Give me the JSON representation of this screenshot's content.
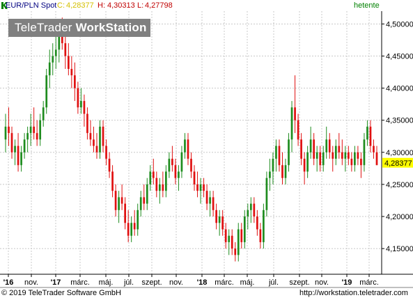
{
  "header": {
    "symbol": "EUR/PLN Spot",
    "close_label": "C:",
    "close_value": "4,28377",
    "high_label": "H:",
    "high_value": "4,30313",
    "low_label": "L:",
    "low_value": "4,27798",
    "period": "hetente"
  },
  "watermark": {
    "part1": "TeleTrader",
    "part2": "WorkStation"
  },
  "footer": {
    "copyright": "© 2019 TeleTrader Software GmbH",
    "url": "http://workstation.teletrader.com"
  },
  "colors": {
    "up": "#1e8c1e",
    "down": "#e01010",
    "grid": "#c8c8c8",
    "price_tag": "#ffff00"
  },
  "chart_data": {
    "type": "candlestick",
    "title": "EUR/PLN Spot",
    "ylim": [
      4.11,
      4.52
    ],
    "y_ticks": [
      "4,50000",
      "4,45000",
      "4,40000",
      "4,35000",
      "4,30000",
      "4,25000",
      "4,20000",
      "4,15000"
    ],
    "y_tick_values": [
      4.5,
      4.45,
      4.4,
      4.35,
      4.3,
      4.25,
      4.2,
      4.15
    ],
    "x_ticks": [
      "'16",
      "nov.",
      "'17",
      "márc.",
      "máj.",
      "júl.",
      "szept.",
      "nov.",
      "'18",
      "márc.",
      "máj.",
      "júl.",
      "szept.",
      "nov.",
      "'19",
      "márc."
    ],
    "last_price_label": "4,28377",
    "last_price": 4.28377,
    "grid": true,
    "series": [
      {
        "values": [
          [
            4.32,
            4.36,
            4.3,
            4.34
          ],
          [
            4.34,
            4.37,
            4.31,
            4.33
          ],
          [
            4.33,
            4.34,
            4.29,
            4.3
          ],
          [
            4.3,
            4.32,
            4.28,
            4.31
          ],
          [
            4.31,
            4.33,
            4.27,
            4.28
          ],
          [
            4.28,
            4.31,
            4.27,
            4.3
          ],
          [
            4.3,
            4.33,
            4.29,
            4.32
          ],
          [
            4.32,
            4.34,
            4.3,
            4.33
          ],
          [
            4.33,
            4.36,
            4.31,
            4.34
          ],
          [
            4.34,
            4.37,
            4.32,
            4.33
          ],
          [
            4.33,
            4.35,
            4.31,
            4.32
          ],
          [
            4.32,
            4.36,
            4.31,
            4.35
          ],
          [
            4.35,
            4.38,
            4.34,
            4.37
          ],
          [
            4.37,
            4.43,
            4.36,
            4.42
          ],
          [
            4.42,
            4.46,
            4.4,
            4.44
          ],
          [
            4.44,
            4.47,
            4.42,
            4.45
          ],
          [
            4.45,
            4.49,
            4.43,
            4.46
          ],
          [
            4.46,
            4.5,
            4.44,
            4.49
          ],
          [
            4.49,
            4.51,
            4.46,
            4.47
          ],
          [
            4.47,
            4.48,
            4.43,
            4.45
          ],
          [
            4.45,
            4.47,
            4.42,
            4.43
          ],
          [
            4.43,
            4.45,
            4.4,
            4.42
          ],
          [
            4.42,
            4.44,
            4.38,
            4.4
          ],
          [
            4.4,
            4.41,
            4.36,
            4.37
          ],
          [
            4.37,
            4.4,
            4.36,
            4.38
          ],
          [
            4.38,
            4.39,
            4.34,
            4.36
          ],
          [
            4.36,
            4.37,
            4.32,
            4.33
          ],
          [
            4.33,
            4.35,
            4.31,
            4.32
          ],
          [
            4.32,
            4.34,
            4.3,
            4.31
          ],
          [
            4.31,
            4.33,
            4.29,
            4.3
          ],
          [
            4.3,
            4.35,
            4.29,
            4.34
          ],
          [
            4.34,
            4.35,
            4.3,
            4.31
          ],
          [
            4.31,
            4.32,
            4.28,
            4.29
          ],
          [
            4.29,
            4.3,
            4.26,
            4.27
          ],
          [
            4.27,
            4.28,
            4.23,
            4.24
          ],
          [
            4.24,
            4.25,
            4.2,
            4.21
          ],
          [
            4.21,
            4.24,
            4.19,
            4.23
          ],
          [
            4.23,
            4.25,
            4.21,
            4.22
          ],
          [
            4.22,
            4.23,
            4.18,
            4.19
          ],
          [
            4.19,
            4.21,
            4.16,
            4.17
          ],
          [
            4.17,
            4.2,
            4.16,
            4.19
          ],
          [
            4.19,
            4.21,
            4.17,
            4.18
          ],
          [
            4.18,
            4.22,
            4.17,
            4.21
          ],
          [
            4.21,
            4.24,
            4.2,
            4.23
          ],
          [
            4.23,
            4.25,
            4.21,
            4.22
          ],
          [
            4.22,
            4.26,
            4.21,
            4.25
          ],
          [
            4.25,
            4.28,
            4.24,
            4.27
          ],
          [
            4.27,
            4.29,
            4.25,
            4.26
          ],
          [
            4.26,
            4.27,
            4.23,
            4.24
          ],
          [
            4.24,
            4.26,
            4.22,
            4.25
          ],
          [
            4.25,
            4.27,
            4.23,
            4.24
          ],
          [
            4.24,
            4.28,
            4.23,
            4.27
          ],
          [
            4.27,
            4.3,
            4.26,
            4.29
          ],
          [
            4.29,
            4.31,
            4.27,
            4.28
          ],
          [
            4.28,
            4.29,
            4.25,
            4.26
          ],
          [
            4.26,
            4.28,
            4.24,
            4.27
          ],
          [
            4.27,
            4.31,
            4.26,
            4.3
          ],
          [
            4.3,
            4.33,
            4.29,
            4.32
          ],
          [
            4.32,
            4.33,
            4.28,
            4.29
          ],
          [
            4.29,
            4.3,
            4.26,
            4.27
          ],
          [
            4.27,
            4.28,
            4.24,
            4.25
          ],
          [
            4.25,
            4.27,
            4.23,
            4.24
          ],
          [
            4.24,
            4.26,
            4.22,
            4.25
          ],
          [
            4.25,
            4.26,
            4.23,
            4.24
          ],
          [
            4.24,
            4.25,
            4.21,
            4.22
          ],
          [
            4.22,
            4.24,
            4.2,
            4.23
          ],
          [
            4.23,
            4.24,
            4.2,
            4.21
          ],
          [
            4.21,
            4.22,
            4.18,
            4.19
          ],
          [
            4.19,
            4.21,
            4.17,
            4.2
          ],
          [
            4.2,
            4.21,
            4.17,
            4.18
          ],
          [
            4.18,
            4.19,
            4.15,
            4.16
          ],
          [
            4.16,
            4.18,
            4.14,
            4.17
          ],
          [
            4.17,
            4.18,
            4.14,
            4.15
          ],
          [
            4.15,
            4.16,
            4.13,
            4.14
          ],
          [
            4.14,
            4.19,
            4.13,
            4.18
          ],
          [
            4.18,
            4.19,
            4.15,
            4.16
          ],
          [
            4.16,
            4.21,
            4.15,
            4.2
          ],
          [
            4.2,
            4.22,
            4.18,
            4.21
          ],
          [
            4.21,
            4.23,
            4.19,
            4.22
          ],
          [
            4.22,
            4.23,
            4.19,
            4.2
          ],
          [
            4.2,
            4.21,
            4.17,
            4.18
          ],
          [
            4.18,
            4.19,
            4.15,
            4.16
          ],
          [
            4.16,
            4.22,
            4.15,
            4.21
          ],
          [
            4.21,
            4.27,
            4.2,
            4.26
          ],
          [
            4.26,
            4.29,
            4.24,
            4.27
          ],
          [
            4.27,
            4.3,
            4.25,
            4.29
          ],
          [
            4.29,
            4.32,
            4.27,
            4.31
          ],
          [
            4.31,
            4.32,
            4.27,
            4.28
          ],
          [
            4.28,
            4.3,
            4.25,
            4.26
          ],
          [
            4.26,
            4.29,
            4.25,
            4.28
          ],
          [
            4.28,
            4.33,
            4.27,
            4.32
          ],
          [
            4.32,
            4.38,
            4.3,
            4.37
          ],
          [
            4.37,
            4.42,
            4.33,
            4.35
          ],
          [
            4.35,
            4.36,
            4.31,
            4.32
          ],
          [
            4.32,
            4.33,
            4.28,
            4.29
          ],
          [
            4.29,
            4.3,
            4.25,
            4.27
          ],
          [
            4.27,
            4.31,
            4.26,
            4.3
          ],
          [
            4.3,
            4.34,
            4.29,
            4.32
          ],
          [
            4.32,
            4.33,
            4.28,
            4.29
          ],
          [
            4.29,
            4.31,
            4.27,
            4.3
          ],
          [
            4.3,
            4.31,
            4.27,
            4.28
          ],
          [
            4.28,
            4.31,
            4.27,
            4.3
          ],
          [
            4.3,
            4.34,
            4.29,
            4.32
          ],
          [
            4.32,
            4.33,
            4.29,
            4.3
          ],
          [
            4.3,
            4.31,
            4.27,
            4.29
          ],
          [
            4.29,
            4.32,
            4.28,
            4.31
          ],
          [
            4.31,
            4.33,
            4.29,
            4.3
          ],
          [
            4.3,
            4.32,
            4.28,
            4.29
          ],
          [
            4.29,
            4.31,
            4.27,
            4.3
          ],
          [
            4.3,
            4.31,
            4.28,
            4.29
          ],
          [
            4.29,
            4.3,
            4.27,
            4.28
          ],
          [
            4.28,
            4.31,
            4.27,
            4.3
          ],
          [
            4.3,
            4.31,
            4.28,
            4.29
          ],
          [
            4.29,
            4.3,
            4.26,
            4.28
          ],
          [
            4.28,
            4.33,
            4.27,
            4.32
          ],
          [
            4.32,
            4.35,
            4.31,
            4.34
          ],
          [
            4.34,
            4.35,
            4.3,
            4.31
          ],
          [
            4.31,
            4.32,
            4.29,
            4.3
          ],
          [
            4.3,
            4.31,
            4.28,
            4.28
          ]
        ]
      }
    ]
  }
}
